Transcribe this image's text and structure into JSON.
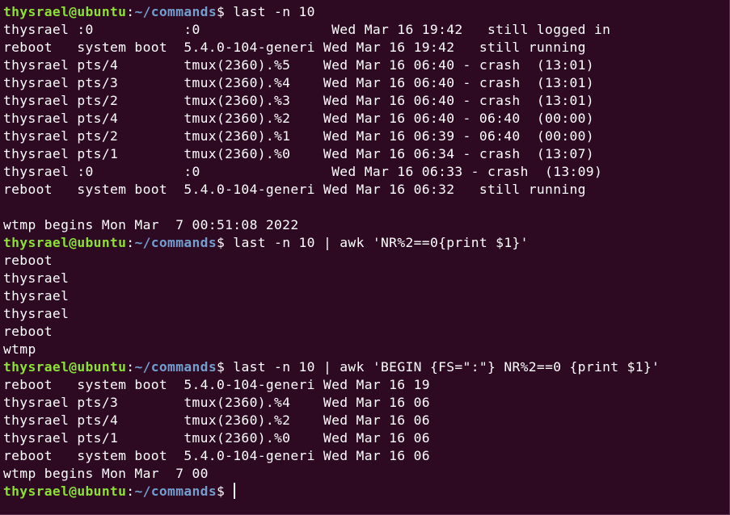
{
  "prompt": {
    "user_host": "thysrael@ubuntu",
    "colon": ":",
    "path": "~/commands",
    "symbol": "$ "
  },
  "command1": "last -n 10",
  "output1": [
    "thysrael :0           :0                Wed Mar 16 19:42   still logged in",
    "reboot   system boot  5.4.0-104-generi Wed Mar 16 19:42   still running",
    "thysrael pts/4        tmux(2360).%5    Wed Mar 16 06:40 - crash  (13:01)",
    "thysrael pts/3        tmux(2360).%4    Wed Mar 16 06:40 - crash  (13:01)",
    "thysrael pts/2        tmux(2360).%3    Wed Mar 16 06:40 - crash  (13:01)",
    "thysrael pts/4        tmux(2360).%2    Wed Mar 16 06:40 - 06:40  (00:00)",
    "thysrael pts/2        tmux(2360).%1    Wed Mar 16 06:39 - 06:40  (00:00)",
    "thysrael pts/1        tmux(2360).%0    Wed Mar 16 06:34 - crash  (13:07)",
    "thysrael :0           :0                Wed Mar 16 06:33 - crash  (13:09)",
    "reboot   system boot  5.4.0-104-generi Wed Mar 16 06:32   still running",
    "",
    "wtmp begins Mon Mar  7 00:51:08 2022"
  ],
  "command2": "last -n 10 | awk 'NR%2==0{print $1}'",
  "output2": [
    "reboot",
    "thysrael",
    "thysrael",
    "thysrael",
    "reboot",
    "wtmp"
  ],
  "command3": "last -n 10 | awk 'BEGIN {FS=\":\"} NR%2==0 {print $1}'",
  "output3": [
    "reboot   system boot  5.4.0-104-generi Wed Mar 16 19",
    "thysrael pts/3        tmux(2360).%4    Wed Mar 16 06",
    "thysrael pts/4        tmux(2360).%2    Wed Mar 16 06",
    "thysrael pts/1        tmux(2360).%0    Wed Mar 16 06",
    "reboot   system boot  5.4.0-104-generi Wed Mar 16 06",
    "wtmp begins Mon Mar  7 00"
  ]
}
